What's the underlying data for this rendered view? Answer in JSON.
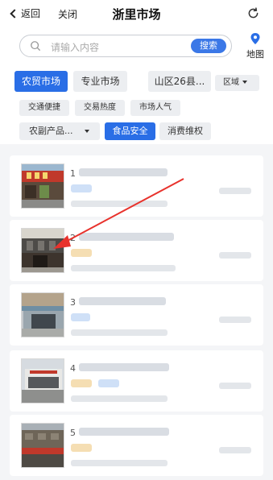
{
  "header": {
    "back_label": "返回",
    "close_label": "关闭",
    "title": "浙里市场"
  },
  "search": {
    "placeholder": "请输入内容",
    "button_label": "搜索",
    "map_label": "地图"
  },
  "tabs": [
    {
      "label": "农贸市场",
      "active": true
    },
    {
      "label": "专业市场",
      "active": false
    },
    {
      "label": "山区26县...",
      "active": false
    }
  ],
  "region_label": "区域",
  "chips": [
    "交通便捷",
    "交易热度",
    "市场人气"
  ],
  "category_dropdown": "农副产品...",
  "chips2": [
    {
      "label": "食品安全",
      "active": true
    },
    {
      "label": "消费维权",
      "active": false
    }
  ],
  "results": [
    {
      "index": "1"
    },
    {
      "index": "2"
    },
    {
      "index": "3"
    },
    {
      "index": "4"
    },
    {
      "index": "5"
    }
  ],
  "colors": {
    "accent": "#2a6ee6",
    "arrow": "#e8322c"
  }
}
